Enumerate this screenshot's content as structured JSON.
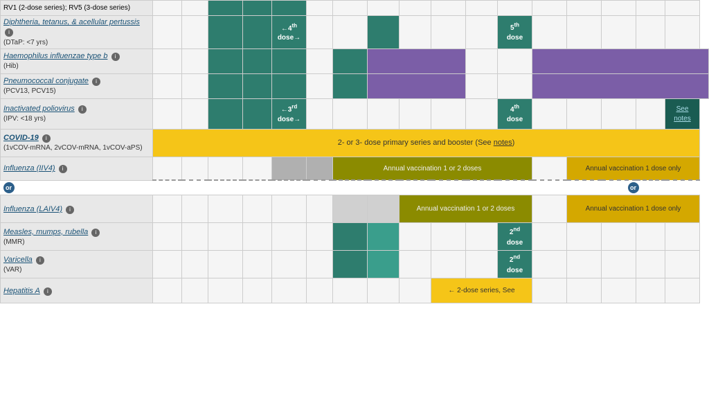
{
  "vaccines": [
    {
      "id": "rv",
      "name": "RV1 (2-dose series); RV5 (3-dose series)",
      "nameLink": false,
      "sub": null,
      "info": true,
      "rowVisible": false
    },
    {
      "id": "dtap",
      "name": "Diphtheria, tetanus, & acellular pertussis",
      "nameLink": true,
      "sub": "(DTaP: <7 yrs)",
      "info": true,
      "doses": {
        "dose4": "←4th dose→",
        "dose5label": "5th",
        "dose5sub": "dose"
      }
    },
    {
      "id": "hib",
      "name": "Haemophilus influenzae type b",
      "nameLink": true,
      "italic": true,
      "sub": "(Hib)",
      "info": true
    },
    {
      "id": "pcv",
      "name": "Pneumococcal conjugate",
      "nameLink": true,
      "sub": "(PCV13, PCV15)",
      "info": true
    },
    {
      "id": "ipv",
      "name": "Inactivated poliovirus",
      "nameLink": true,
      "sub": "(IPV: <18 yrs)",
      "info": true,
      "doses": {
        "dose3": "←3rd dose→",
        "dose4label": "4th",
        "dose4sub": "dose",
        "seeNotes": "See notes"
      }
    },
    {
      "id": "covid",
      "name": "COVID-19",
      "nameLink": true,
      "sub": "(1vCOV-mRNA, 2vCOV-mRNA, 1vCOV-aPS)",
      "info": true,
      "bannerText": "2- or 3- dose primary series and booster (See notes)"
    },
    {
      "id": "influenza-iiv4",
      "name": "Influenza (IIV4)",
      "nameLink": true,
      "info": true,
      "annual1": "Annual vaccination 1 or 2 doses",
      "annual2": "Annual vaccination 1 dose only"
    },
    {
      "id": "influenza-laiv4",
      "name": "Influenza (LAIV4)",
      "nameLink": true,
      "info": true,
      "annual1": "Annual vaccination 1 or 2 doses",
      "annual2": "Annual vaccination 1 dose only"
    },
    {
      "id": "mmr",
      "name": "Measles, mumps, rubella",
      "nameLink": true,
      "sub": "(MMR)",
      "info": true,
      "doses": {
        "dose2label": "2nd",
        "dose2sub": "dose"
      }
    },
    {
      "id": "varicella",
      "name": "Varicella",
      "nameLink": true,
      "sub": "(VAR)",
      "info": true,
      "doses": {
        "dose2label": "2nd",
        "dose2sub": "dose"
      }
    },
    {
      "id": "hepa",
      "name": "Hepatitis A",
      "nameLink": true,
      "info": true,
      "doses": {
        "banner": "← 2-dose series, See"
      }
    }
  ],
  "or_label": "or",
  "notes_label": "notes"
}
